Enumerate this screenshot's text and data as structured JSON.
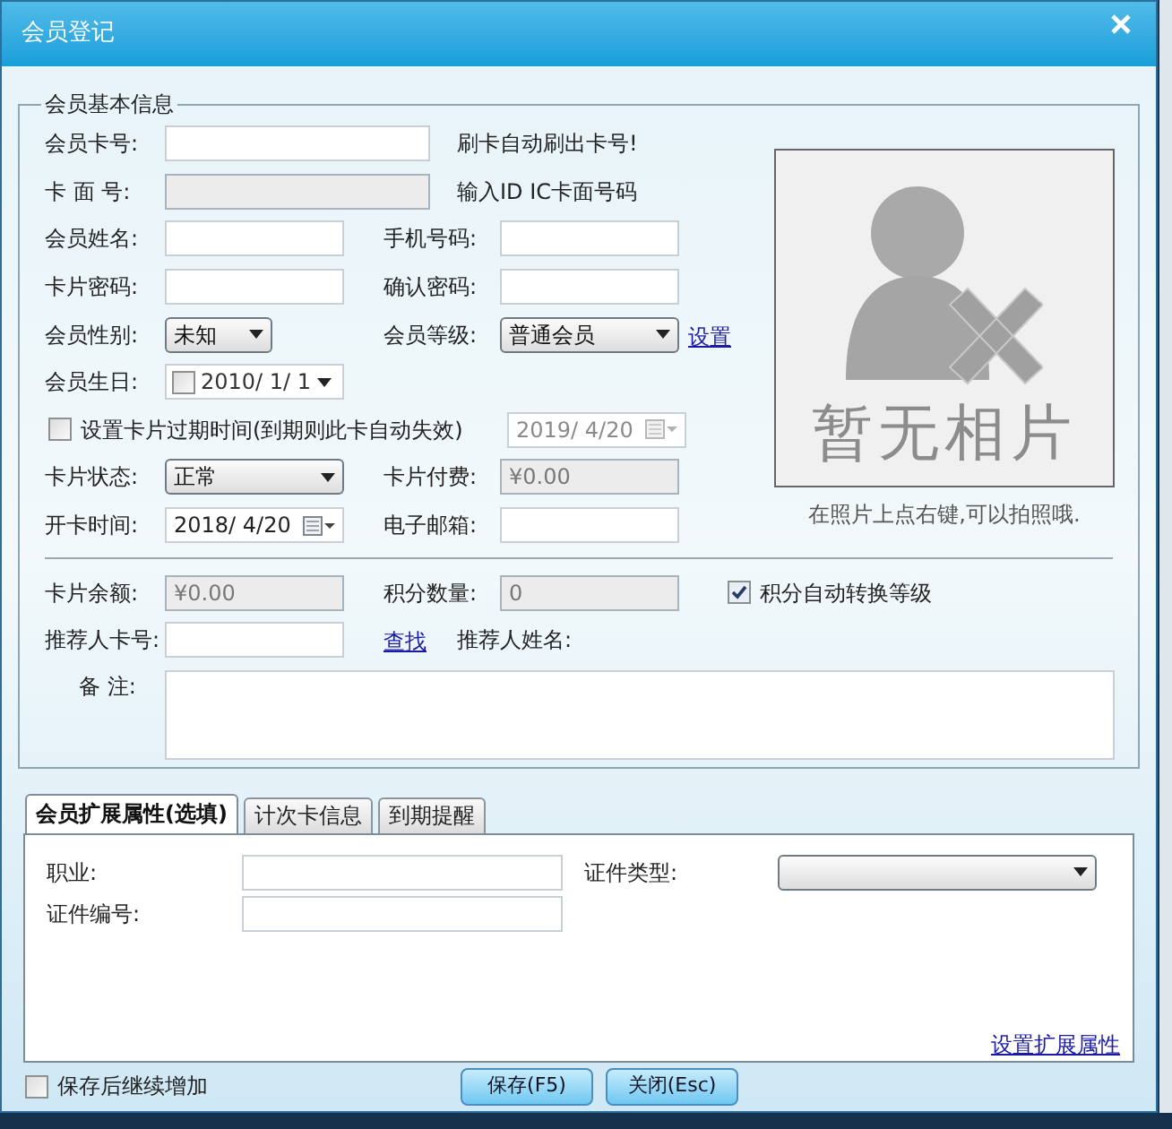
{
  "window": {
    "title": "会员登记"
  },
  "basic_info": {
    "legend": "会员基本信息",
    "card_no": {
      "label": "会员卡号:",
      "hint": "刷卡自动刷出卡号!"
    },
    "card_face_no": {
      "label": "卡 面 号:",
      "disabled": true,
      "hint": "输入ID IC卡面号码"
    },
    "name": {
      "label": "会员姓名:"
    },
    "mobile": {
      "label": "手机号码:"
    },
    "password": {
      "label": "卡片密码:"
    },
    "confirm_password": {
      "label": "确认密码:"
    },
    "gender": {
      "label": "会员性别:",
      "value": "未知"
    },
    "level": {
      "label": "会员等级:",
      "value": "普通会员",
      "link": "设置"
    },
    "birthday": {
      "label": "会员生日:",
      "value": "2010/ 1/ 1",
      "checked": false
    },
    "expiry": {
      "label": "设置卡片过期时间(到期则此卡自动失效)",
      "checked": false,
      "date": "2019/ 4/20",
      "disabled": true
    },
    "status": {
      "label": "卡片状态:",
      "value": "正常"
    },
    "fee": {
      "label": "卡片付费:",
      "value": "¥0.00",
      "disabled": true
    },
    "open_date": {
      "label": "开卡时间:",
      "value": "2018/ 4/20"
    },
    "email": {
      "label": "电子邮箱:"
    },
    "photo": {
      "placeholder": "暂无相片",
      "caption": "在照片上点右键,可以拍照哦."
    },
    "balance": {
      "label": "卡片余额:",
      "value": "¥0.00",
      "disabled": true
    },
    "points": {
      "label": "积分数量:",
      "value": "0",
      "disabled": true
    },
    "auto_level": {
      "label": "积分自动转换等级",
      "checked": true
    },
    "referrer_card": {
      "label": "推荐人卡号:",
      "link": "查找"
    },
    "referrer_name": {
      "label": "推荐人姓名:"
    },
    "remark": {
      "label": "备 注:"
    }
  },
  "tabs": [
    {
      "label": "会员扩展属性(选填)",
      "selected": true
    },
    {
      "label": "计次卡信息",
      "selected": false
    },
    {
      "label": "到期提醒",
      "selected": false
    }
  ],
  "extended": {
    "job": {
      "label": "职业:"
    },
    "id_type": {
      "label": "证件类型:"
    },
    "id_no": {
      "label": "证件编号:"
    },
    "link": "设置扩展属性"
  },
  "footer": {
    "continue": {
      "label": "保存后继续增加",
      "checked": false
    },
    "buttons": [
      "保存(F5)",
      "关闭(Esc)"
    ]
  }
}
